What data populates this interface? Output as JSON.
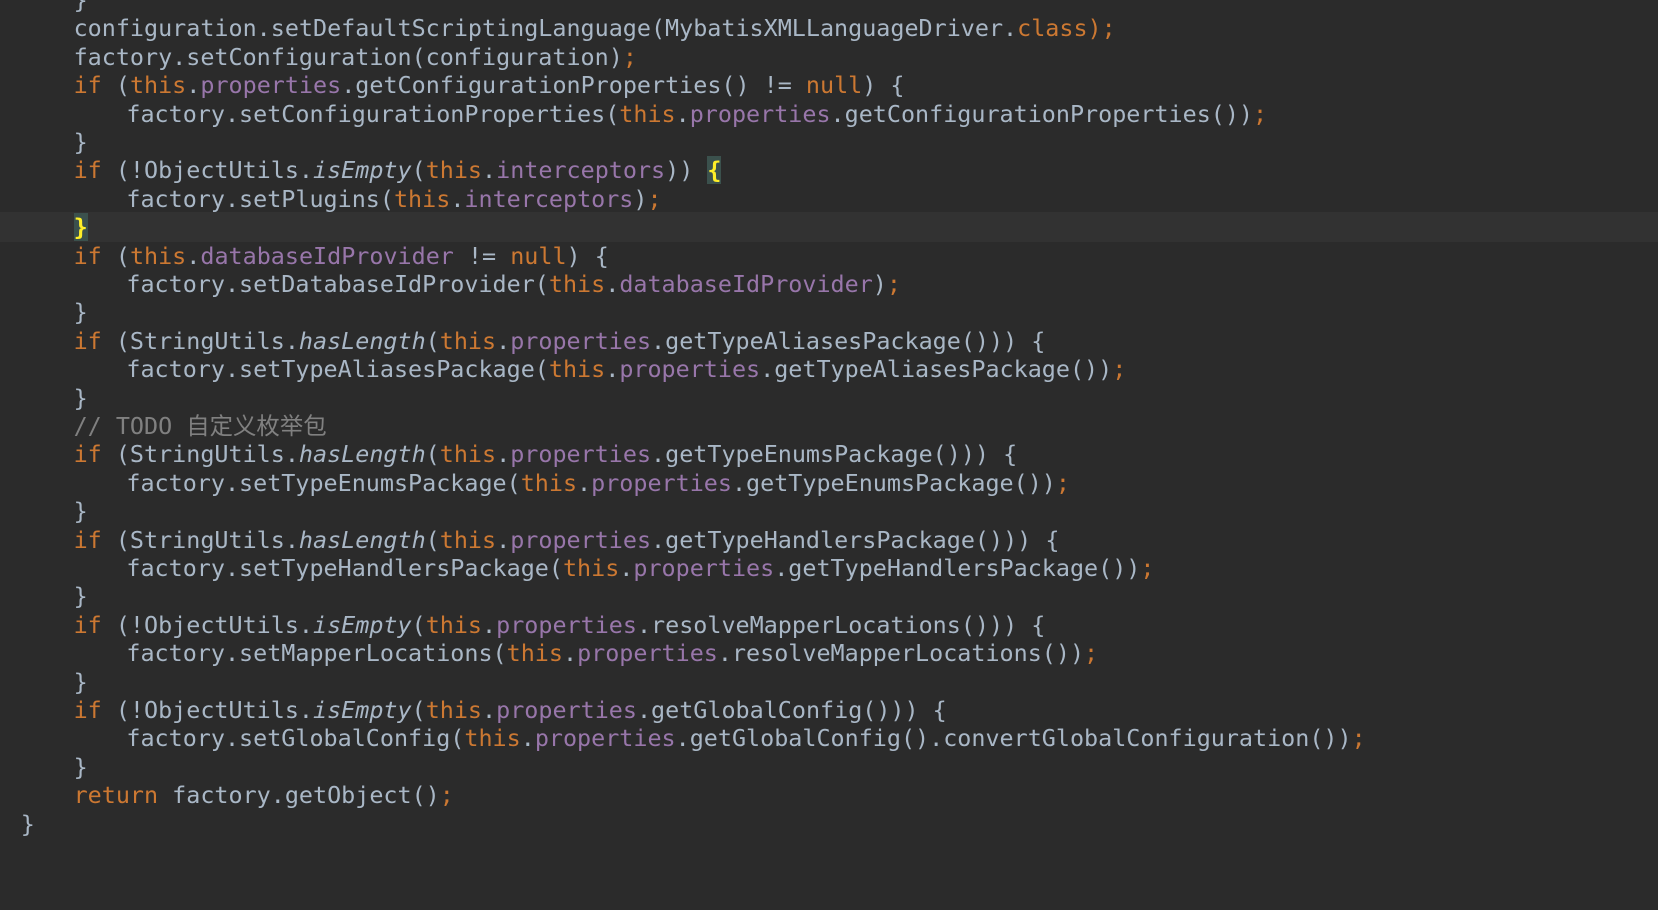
{
  "editor": {
    "language": "java",
    "theme_colors": {
      "background": "#2b2b2b",
      "current_line": "#323232",
      "text": "#a9b7c6",
      "keyword": "#cc7832",
      "field": "#9876aa",
      "comment": "#808080",
      "brace_match": "#ffef28"
    },
    "highlighted_line_index": 8,
    "lines": [
      {
        "indent": 8,
        "tokens": [
          [
            "}",
            "p"
          ]
        ]
      },
      {
        "indent": 8,
        "tokens": [
          [
            "configuration.setDefaultScriptingLanguage(MybatisXMLLanguageDriver.",
            "p"
          ],
          [
            "class",
            "kw"
          ],
          [
            ");",
            "kw"
          ]
        ]
      },
      {
        "indent": 8,
        "tokens": [
          [
            "factory.setConfiguration(configuration)",
            "p"
          ],
          [
            ";",
            "kw"
          ]
        ]
      },
      {
        "indent": 8,
        "tokens": [
          [
            "if",
            "kw"
          ],
          [
            " (",
            "p"
          ],
          [
            "this",
            "kw"
          ],
          [
            ".",
            "p"
          ],
          [
            "properties",
            "fld"
          ],
          [
            ".getConfigurationProperties() != ",
            "p"
          ],
          [
            "null",
            "kw"
          ],
          [
            ") {",
            "p"
          ]
        ]
      },
      {
        "indent": 12,
        "tokens": [
          [
            "factory.setConfigurationProperties(",
            "p"
          ],
          [
            "this",
            "kw"
          ],
          [
            ".",
            "p"
          ],
          [
            "properties",
            "fld"
          ],
          [
            ".getConfigurationProperties())",
            "p"
          ],
          [
            ";",
            "kw"
          ]
        ]
      },
      {
        "indent": 8,
        "tokens": [
          [
            "}",
            "p"
          ]
        ]
      },
      {
        "indent": 8,
        "tokens": [
          [
            "if",
            "kw"
          ],
          [
            " (!ObjectUtils.",
            "p"
          ],
          [
            "isEmpty",
            "ital"
          ],
          [
            "(",
            "p"
          ],
          [
            "this",
            "kw"
          ],
          [
            ".",
            "p"
          ],
          [
            "interceptors",
            "fld"
          ],
          [
            ")) ",
            "p"
          ],
          [
            "{",
            "hl"
          ]
        ]
      },
      {
        "indent": 12,
        "tokens": [
          [
            "factory.setPlugins(",
            "p"
          ],
          [
            "this",
            "kw"
          ],
          [
            ".",
            "p"
          ],
          [
            "interceptors",
            "fld"
          ],
          [
            ")",
            "p"
          ],
          [
            ";",
            "kw"
          ]
        ]
      },
      {
        "indent": 8,
        "tokens": [
          [
            "}",
            "hl"
          ]
        ]
      },
      {
        "indent": 8,
        "tokens": [
          [
            "if",
            "kw"
          ],
          [
            " (",
            "p"
          ],
          [
            "this",
            "kw"
          ],
          [
            ".",
            "p"
          ],
          [
            "databaseIdProvider",
            "fld"
          ],
          [
            " != ",
            "p"
          ],
          [
            "null",
            "kw"
          ],
          [
            ") {",
            "p"
          ]
        ]
      },
      {
        "indent": 12,
        "tokens": [
          [
            "factory.setDatabaseIdProvider(",
            "p"
          ],
          [
            "this",
            "kw"
          ],
          [
            ".",
            "p"
          ],
          [
            "databaseIdProvider",
            "fld"
          ],
          [
            ")",
            "p"
          ],
          [
            ";",
            "kw"
          ]
        ]
      },
      {
        "indent": 8,
        "tokens": [
          [
            "}",
            "p"
          ]
        ]
      },
      {
        "indent": 8,
        "tokens": [
          [
            "if",
            "kw"
          ],
          [
            " (StringUtils.",
            "p"
          ],
          [
            "hasLength",
            "ital"
          ],
          [
            "(",
            "p"
          ],
          [
            "this",
            "kw"
          ],
          [
            ".",
            "p"
          ],
          [
            "properties",
            "fld"
          ],
          [
            ".getTypeAliasesPackage())) {",
            "p"
          ]
        ]
      },
      {
        "indent": 12,
        "tokens": [
          [
            "factory.setTypeAliasesPackage(",
            "p"
          ],
          [
            "this",
            "kw"
          ],
          [
            ".",
            "p"
          ],
          [
            "properties",
            "fld"
          ],
          [
            ".getTypeAliasesPackage())",
            "p"
          ],
          [
            ";",
            "kw"
          ]
        ]
      },
      {
        "indent": 8,
        "tokens": [
          [
            "}",
            "p"
          ]
        ]
      },
      {
        "indent": 8,
        "tokens": [
          [
            "// TODO 自定义枚举包",
            "cmt"
          ]
        ]
      },
      {
        "indent": 8,
        "tokens": [
          [
            "if",
            "kw"
          ],
          [
            " (StringUtils.",
            "p"
          ],
          [
            "hasLength",
            "ital"
          ],
          [
            "(",
            "p"
          ],
          [
            "this",
            "kw"
          ],
          [
            ".",
            "p"
          ],
          [
            "properties",
            "fld"
          ],
          [
            ".getTypeEnumsPackage())) {",
            "p"
          ]
        ]
      },
      {
        "indent": 12,
        "tokens": [
          [
            "factory.setTypeEnumsPackage(",
            "p"
          ],
          [
            "this",
            "kw"
          ],
          [
            ".",
            "p"
          ],
          [
            "properties",
            "fld"
          ],
          [
            ".getTypeEnumsPackage())",
            "p"
          ],
          [
            ";",
            "kw"
          ]
        ]
      },
      {
        "indent": 8,
        "tokens": [
          [
            "}",
            "p"
          ]
        ]
      },
      {
        "indent": 8,
        "tokens": [
          [
            "if",
            "kw"
          ],
          [
            " (StringUtils.",
            "p"
          ],
          [
            "hasLength",
            "ital"
          ],
          [
            "(",
            "p"
          ],
          [
            "this",
            "kw"
          ],
          [
            ".",
            "p"
          ],
          [
            "properties",
            "fld"
          ],
          [
            ".getTypeHandlersPackage())) {",
            "p"
          ]
        ]
      },
      {
        "indent": 12,
        "tokens": [
          [
            "factory.setTypeHandlersPackage(",
            "p"
          ],
          [
            "this",
            "kw"
          ],
          [
            ".",
            "p"
          ],
          [
            "properties",
            "fld"
          ],
          [
            ".getTypeHandlersPackage())",
            "p"
          ],
          [
            ";",
            "kw"
          ]
        ]
      },
      {
        "indent": 8,
        "tokens": [
          [
            "}",
            "p"
          ]
        ]
      },
      {
        "indent": 8,
        "tokens": [
          [
            "if",
            "kw"
          ],
          [
            " (!ObjectUtils.",
            "p"
          ],
          [
            "isEmpty",
            "ital"
          ],
          [
            "(",
            "p"
          ],
          [
            "this",
            "kw"
          ],
          [
            ".",
            "p"
          ],
          [
            "properties",
            "fld"
          ],
          [
            ".resolveMapperLocations())) {",
            "p"
          ]
        ]
      },
      {
        "indent": 12,
        "tokens": [
          [
            "factory.setMapperLocations(",
            "p"
          ],
          [
            "this",
            "kw"
          ],
          [
            ".",
            "p"
          ],
          [
            "properties",
            "fld"
          ],
          [
            ".resolveMapperLocations())",
            "p"
          ],
          [
            ";",
            "kw"
          ]
        ]
      },
      {
        "indent": 8,
        "tokens": [
          [
            "}",
            "p"
          ]
        ]
      },
      {
        "indent": 8,
        "tokens": [
          [
            "if",
            "kw"
          ],
          [
            " (!ObjectUtils.",
            "p"
          ],
          [
            "isEmpty",
            "ital"
          ],
          [
            "(",
            "p"
          ],
          [
            "this",
            "kw"
          ],
          [
            ".",
            "p"
          ],
          [
            "properties",
            "fld"
          ],
          [
            ".getGlobalConfig())) {",
            "p"
          ]
        ]
      },
      {
        "indent": 12,
        "tokens": [
          [
            "factory.setGlobalConfig(",
            "p"
          ],
          [
            "this",
            "kw"
          ],
          [
            ".",
            "p"
          ],
          [
            "properties",
            "fld"
          ],
          [
            ".getGlobalConfig().convertGlobalConfiguration())",
            "p"
          ],
          [
            ";",
            "kw"
          ]
        ]
      },
      {
        "indent": 8,
        "tokens": [
          [
            "}",
            "p"
          ]
        ]
      },
      {
        "indent": 8,
        "tokens": [
          [
            "return",
            "kw"
          ],
          [
            " factory.getObject()",
            "p"
          ],
          [
            ";",
            "kw"
          ]
        ]
      },
      {
        "indent": 4,
        "tokens": [
          [
            "}",
            "p"
          ]
        ]
      }
    ]
  }
}
